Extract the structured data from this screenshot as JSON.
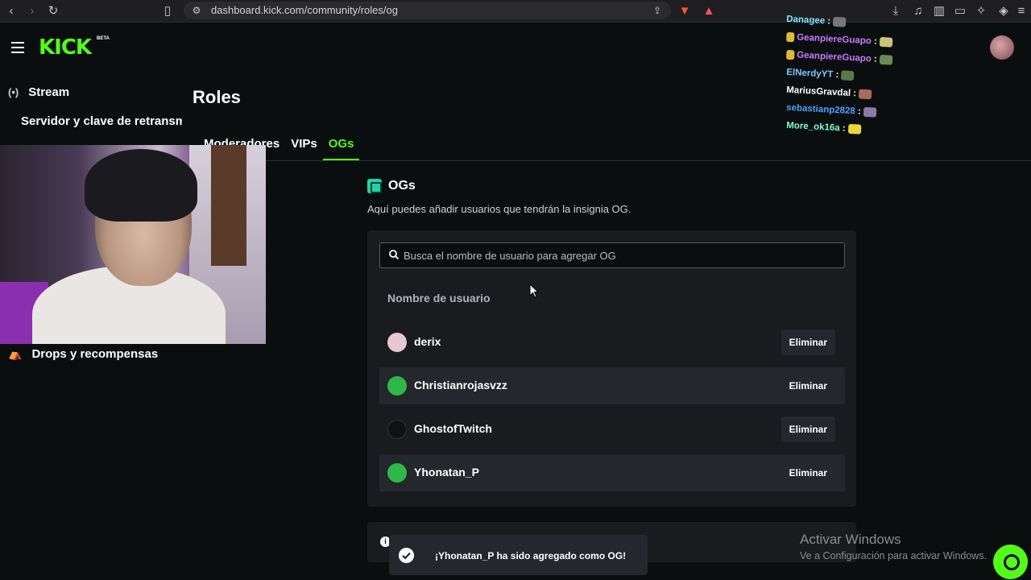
{
  "browser": {
    "url": "dashboard.kick.com/community/roles/og"
  },
  "header": {
    "logo_text": "KICK",
    "logo_badge": "BETA"
  },
  "sidebar": {
    "items": [
      {
        "label": "Stream",
        "icon": "broadcast-icon"
      },
      {
        "label": "Servidor y clave de retransm"
      },
      {
        "label": "Drops y recompensas",
        "icon": "gift-icon"
      }
    ]
  },
  "main": {
    "title": "Roles",
    "tabs": [
      {
        "label": "Moderadores",
        "active": false
      },
      {
        "label": "VIPs",
        "active": false
      },
      {
        "label": "OGs",
        "active": true
      }
    ],
    "section_title": "OGs",
    "section_description": "Aquí puedes añadir usuarios que tendrán la insignia OG.",
    "search_placeholder": "Busca el nombre de usuario para agregar OG",
    "column_header": "Nombre de usuario",
    "users": [
      {
        "name": "derix",
        "action": "Eliminar",
        "avatar_color": "#e6c8d0"
      },
      {
        "name": "Christianrojasvzz",
        "action": "Eliminar",
        "avatar_color": "#2fb84a"
      },
      {
        "name": "GhostofTwitch",
        "action": "Eliminar",
        "avatar_color": "#111111"
      },
      {
        "name": "Yhonatan_P",
        "action": "Eliminar",
        "avatar_color": "#2fb84a"
      }
    ]
  },
  "toast": {
    "message": "¡Yhonatan_P ha sido agregado como OG!"
  },
  "chat_overlay": [
    {
      "user": "Danagee",
      "color": "#7fe3ff"
    },
    {
      "user": "GeanpiereGuapo",
      "color": "#c47cff"
    },
    {
      "user": "GeanpiereGuapo",
      "color": "#c47cff"
    },
    {
      "user": "ElNerdyYT",
      "color": "#7fc8ff"
    },
    {
      "user": "MariusGravdal",
      "color": "#ffffff"
    },
    {
      "user": "sebastianp2828",
      "color": "#4fa3ff"
    },
    {
      "user": "More_ok16a",
      "color": "#7fffcf"
    }
  ],
  "watermark": {
    "title": "Activar Windows",
    "subtitle": "Ve a Configuración para activar Windows."
  },
  "colors": {
    "accent": "#53fc18",
    "background": "#0b0e0f",
    "panel": "#191b1f"
  }
}
